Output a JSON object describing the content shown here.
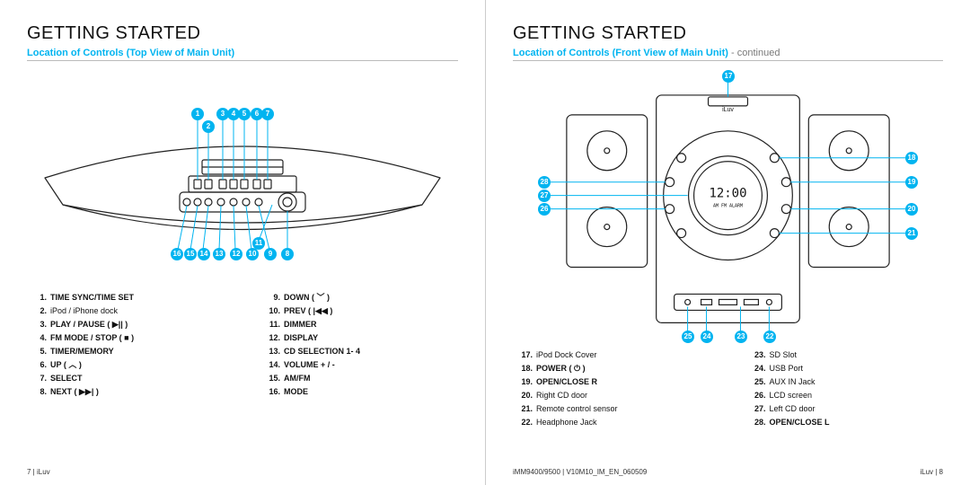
{
  "brand": "iLuv",
  "model_footer": "iMM9400/9500 | V10M10_IM_EN_060509",
  "section_title": "GETTING STARTED",
  "left": {
    "page_num": "7 | iLuv",
    "subtitle": "Location of Controls (Top View of Main Unit)",
    "controls": [
      {
        "n": "1.",
        "t": "TIME SYNC/TIME SET",
        "b": true
      },
      {
        "n": "2.",
        "t": "iPod / iPhone dock",
        "b": false
      },
      {
        "n": "3.",
        "t": "PLAY / PAUSE ( ▶|| )",
        "b": true
      },
      {
        "n": "4.",
        "t": "FM MODE / STOP ( ■ )",
        "b": true
      },
      {
        "n": "5.",
        "t": "TIMER/MEMORY",
        "b": true
      },
      {
        "n": "6.",
        "t": "UP ( ︿ )",
        "b": true
      },
      {
        "n": "7.",
        "t": "SELECT",
        "b": true
      },
      {
        "n": "8.",
        "t": "NEXT ( ▶▶| )",
        "b": true
      },
      {
        "n": "9.",
        "t": " DOWN ( ﹀ )",
        "b": true
      },
      {
        "n": "10.",
        "t": "PREV ( |◀◀ )",
        "b": true
      },
      {
        "n": "11.",
        "t": "DIMMER",
        "b": true
      },
      {
        "n": "12.",
        "t": "DISPLAY",
        "b": true
      },
      {
        "n": "13.",
        "t": "CD SELECTION 1- 4",
        "b": true
      },
      {
        "n": "14.",
        "t": "VOLUME + / -",
        "b": true
      },
      {
        "n": "15.",
        "t": "AM/FM",
        "b": true
      },
      {
        "n": "16.",
        "t": "MODE",
        "b": true
      }
    ]
  },
  "right": {
    "page_num": "iLuv | 8",
    "subtitle_main": "Location of Controls (Front View of Main Unit)",
    "subtitle_cont": " - continued",
    "lcd_time": "12:00",
    "controls": [
      {
        "n": "17.",
        "t": "iPod Dock Cover",
        "b": false
      },
      {
        "n": "18.",
        "t": "POWER ( ⏻ )",
        "b": true
      },
      {
        "n": "19.",
        "t": "OPEN/CLOSE R",
        "b": true
      },
      {
        "n": "20.",
        "t": "Right CD door",
        "b": false
      },
      {
        "n": "21.",
        "t": "Remote control sensor",
        "b": false
      },
      {
        "n": "22.",
        "t": "Headphone Jack",
        "b": false
      },
      {
        "n": "23.",
        "t": "SD Slot",
        "b": false
      },
      {
        "n": "24.",
        "t": "USB Port",
        "b": false
      },
      {
        "n": "25.",
        "t": "AUX IN Jack",
        "b": false
      },
      {
        "n": "26.",
        "t": "LCD screen",
        "b": false
      },
      {
        "n": "27.",
        "t": "Left CD door",
        "b": false
      },
      {
        "n": "28.",
        "t": "OPEN/CLOSE L",
        "b": true
      }
    ],
    "bubbles_right_side": [
      "18",
      "19",
      "20",
      "21"
    ],
    "bubbles_left_side": [
      "28",
      "27",
      "26"
    ],
    "bubbles_bottom": [
      "25",
      "24",
      "23",
      "22"
    ],
    "bubble_top": "17"
  },
  "icons": {
    "play_pause": "▶||",
    "stop": "■",
    "up": "︿",
    "down": "﹀",
    "next": "▶▶|",
    "prev": "|◀◀",
    "power": "⏻"
  },
  "colors": {
    "accent": "#00b4f0"
  }
}
